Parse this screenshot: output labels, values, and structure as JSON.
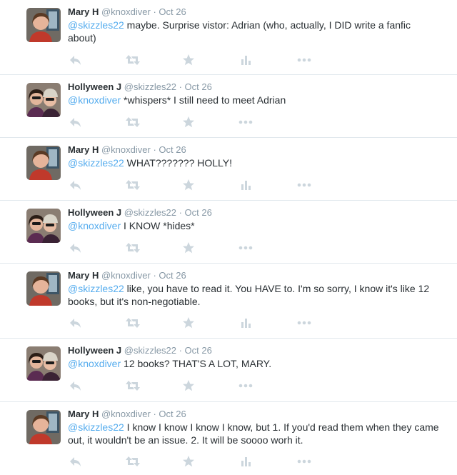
{
  "colors": {
    "accent": "#55acee",
    "meta": "#8899a6",
    "icon": "#ccd6dd",
    "text": "#292f33",
    "divider": "#e1e8ed"
  },
  "separator": "·",
  "tweets": [
    {
      "name": "Mary H",
      "handle": "@knoxdiver",
      "time": "Oct 26",
      "mention": "@skizzles22",
      "body": " maybe. Surprise vistor: Adrian (who, actually, I DID write a fanfic about)",
      "avatar": "mary",
      "has_stats": true
    },
    {
      "name": "Hollyween J",
      "handle": "@skizzles22",
      "time": "Oct 26",
      "mention": "@knoxdiver",
      "body": " *whispers* I still need to meet Adrian",
      "avatar": "holly",
      "has_stats": false
    },
    {
      "name": "Mary H",
      "handle": "@knoxdiver",
      "time": "Oct 26",
      "mention": "@skizzles22",
      "body": " WHAT??????? HOLLY!",
      "avatar": "mary",
      "has_stats": true
    },
    {
      "name": "Hollyween J",
      "handle": "@skizzles22",
      "time": "Oct 26",
      "mention": "@knoxdiver",
      "body": " I KNOW *hides*",
      "avatar": "holly",
      "has_stats": false
    },
    {
      "name": "Mary H",
      "handle": "@knoxdiver",
      "time": "Oct 26",
      "mention": "@skizzles22",
      "body": " like, you have to read it. You HAVE to. I'm so sorry, I know it's like 12 books, but it's non-negotiable.",
      "avatar": "mary",
      "has_stats": true
    },
    {
      "name": "Hollyween J",
      "handle": "@skizzles22",
      "time": "Oct 26",
      "mention": "@knoxdiver",
      "body": " 12 books? THAT'S A LOT, MARY.",
      "avatar": "holly",
      "has_stats": false
    },
    {
      "name": "Mary H",
      "handle": "@knoxdiver",
      "time": "Oct 26",
      "mention": "@skizzles22",
      "body": " I know I know I know I know, but 1. If you'd read them when they came out, it wouldn't be an issue. 2. It will be soooo worh it.",
      "avatar": "mary",
      "has_stats": true
    }
  ]
}
